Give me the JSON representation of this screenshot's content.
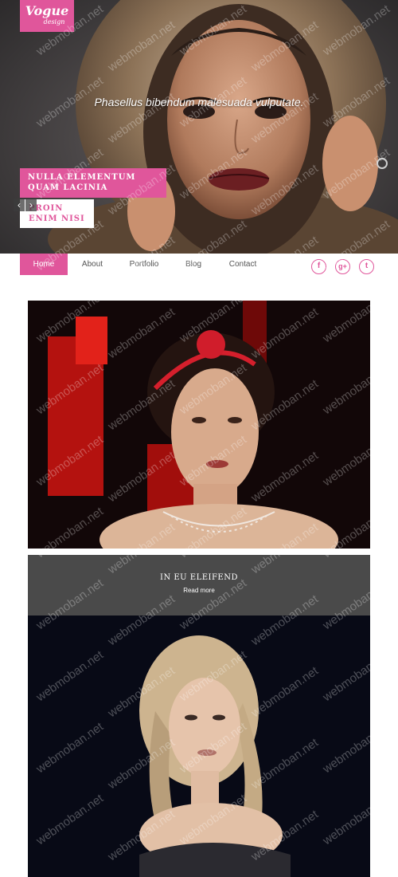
{
  "brand": {
    "logo_main": "Vogue",
    "logo_sub": "design"
  },
  "hero": {
    "caption": "Phasellus bibendum malesuada vulputate.",
    "banner_primary": [
      "NULLA ELEMENTUM",
      "QUAM LACINIA"
    ],
    "banner_secondary": [
      "PROIN",
      "ENIM NISI"
    ],
    "prev_arrow": "‹",
    "next_arrow": "›"
  },
  "nav": {
    "items": [
      {
        "label": "Home",
        "active": true
      },
      {
        "label": "About",
        "active": false
      },
      {
        "label": "Portfolio",
        "active": false
      },
      {
        "label": "Blog",
        "active": false
      },
      {
        "label": "Contact",
        "active": false
      }
    ]
  },
  "social": {
    "facebook": "f",
    "google_plus": "g+",
    "twitter": "t"
  },
  "post_card": {
    "title": "IN EU ELEIFEND",
    "link": "Read more"
  },
  "watermark": "webmoban.net",
  "colors": {
    "accent": "#e0569b",
    "card_bg": "#4a4a4a",
    "text": "#555555"
  }
}
